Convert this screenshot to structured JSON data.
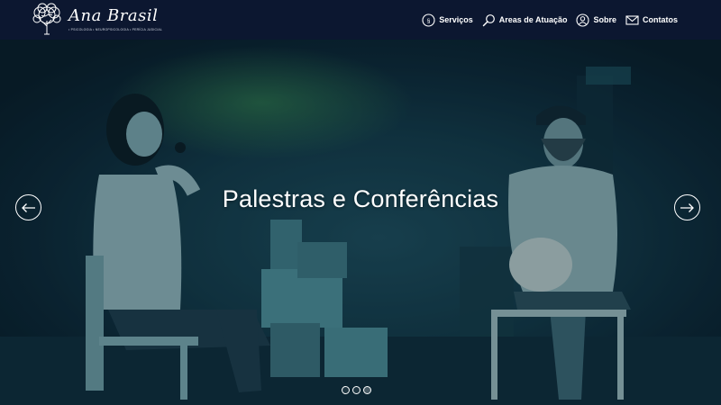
{
  "brand": {
    "name": "Ana Brasil",
    "tagline": "• PSICOLOGIA • NEUROPSICOLOGIA • PERÍCIA JUDICIAL"
  },
  "nav": {
    "items": [
      {
        "label": "Serviços",
        "icon": "services-icon"
      },
      {
        "label": "Areas de Atuação",
        "icon": "search-icon"
      },
      {
        "label": "Sobre",
        "icon": "user-icon"
      },
      {
        "label": "Contatos",
        "icon": "mail-icon"
      }
    ]
  },
  "hero": {
    "title": "Palestras e Conferências",
    "slide_count": 3,
    "active_slide": 3
  },
  "colors": {
    "header_bg": "#0c1730",
    "hero_tint": "#123746",
    "text": "#ffffff"
  }
}
